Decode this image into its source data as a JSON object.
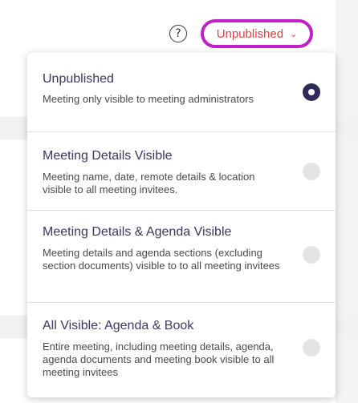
{
  "header": {
    "help_icon": "question-circle-icon",
    "help_glyph": "?",
    "status_button": {
      "label": "Unpublished",
      "chevron_icon": "chevron-down-icon",
      "chevron_glyph": "⌄",
      "label_color": "#e0443c",
      "highlight_color": "#c21fc9"
    }
  },
  "dropdown": {
    "options": [
      {
        "title": "Unpublished",
        "description": "Meeting only visible to meeting administrators",
        "selected": true
      },
      {
        "title": "Meeting Details Visible",
        "description": "Meeting name, date, remote details & location visible to all meeting invitees.",
        "selected": false
      },
      {
        "title": "Meeting Details & Agenda Visible",
        "description": "Meeting details and agenda sections (excluding section documents) visible to to all meeting invitees",
        "selected": false
      },
      {
        "title": "All Visible: Agenda & Book",
        "description": "Entire meeting, including meeting details, agenda, agenda documents and meeting book visible to all meeting invitees",
        "selected": false
      }
    ]
  },
  "colors": {
    "title_text": "#3c3667",
    "radio_selected": "#2f2c5a",
    "radio_unselected": "#e4e4e6"
  }
}
